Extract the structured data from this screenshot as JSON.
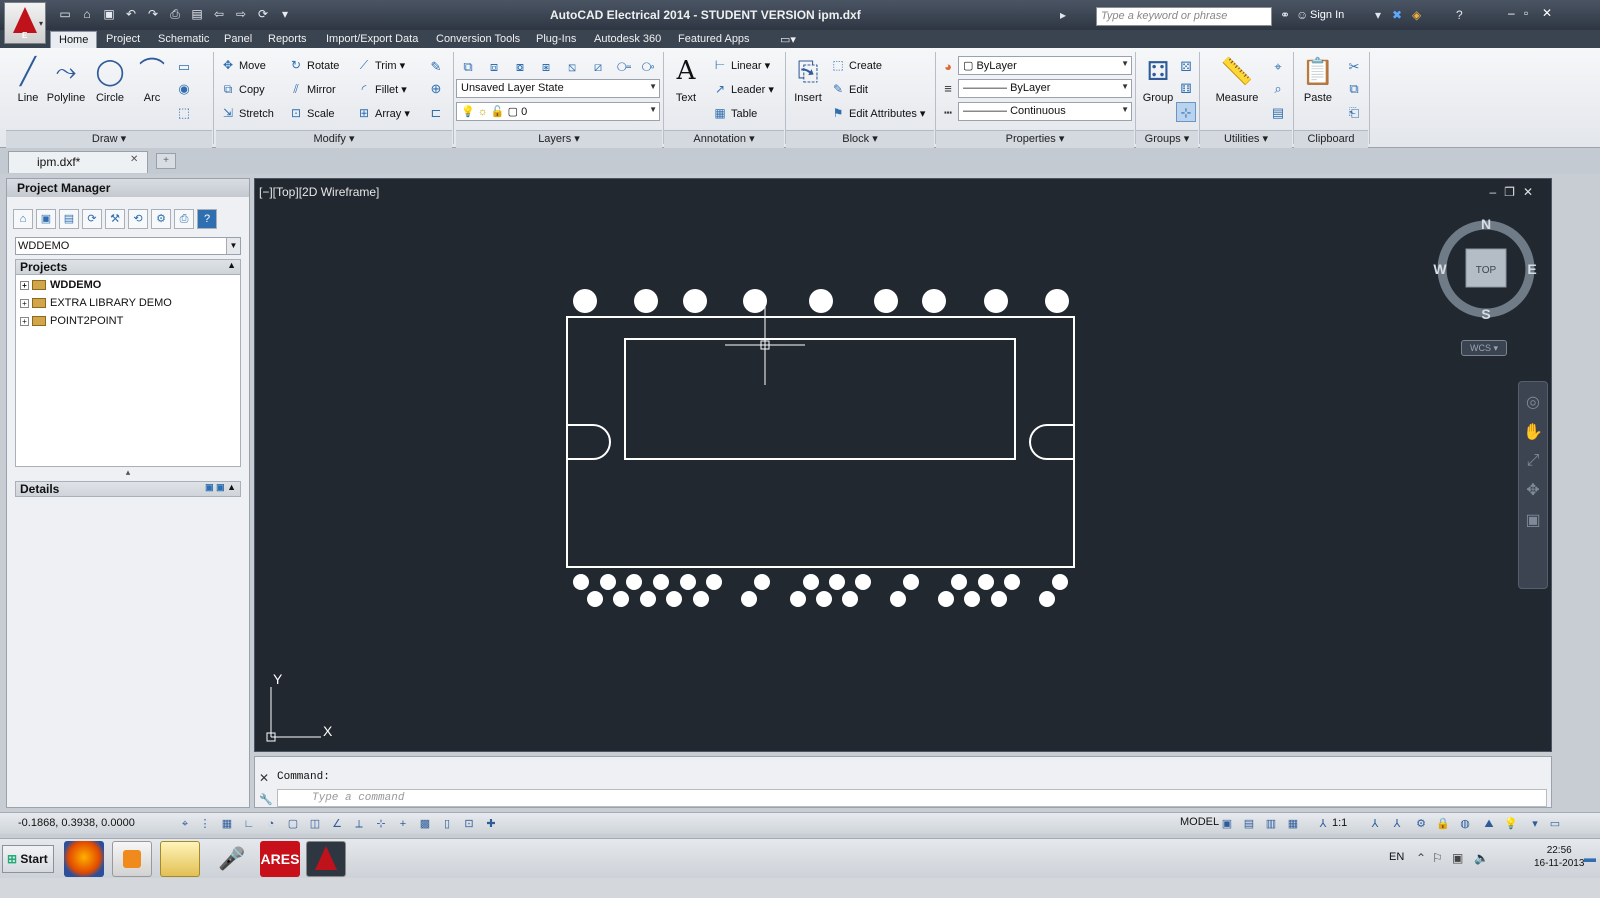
{
  "titlebar": {
    "app_letter": "E",
    "title": "AutoCAD Electrical 2014 - STUDENT VERSION    ipm.dxf",
    "search_placeholder": "Type a keyword or phrase",
    "signin": "Sign In"
  },
  "tabs": [
    "Home",
    "Project",
    "Schematic",
    "Panel",
    "Reports",
    "Import/Export Data",
    "Conversion Tools",
    "Plug-Ins",
    "Autodesk 360",
    "Featured Apps"
  ],
  "active_tab": "Home",
  "ribbon": {
    "draw": {
      "title": "Draw",
      "line": "Line",
      "polyline": "Polyline",
      "circle": "Circle",
      "arc": "Arc"
    },
    "modify": {
      "title": "Modify",
      "move": "Move",
      "rotate": "Rotate",
      "trim": "Trim",
      "copy": "Copy",
      "mirror": "Mirror",
      "fillet": "Fillet",
      "stretch": "Stretch",
      "scale": "Scale",
      "array": "Array"
    },
    "layers": {
      "title": "Layers",
      "layer_state": "Unsaved Layer State",
      "current_layer": "0"
    },
    "annotation": {
      "title": "Annotation",
      "text": "Text",
      "linear": "Linear",
      "leader": "Leader",
      "table": "Table"
    },
    "block": {
      "title": "Block",
      "insert": "Insert",
      "create": "Create",
      "edit": "Edit",
      "edit_attributes": "Edit Attributes"
    },
    "properties": {
      "title": "Properties",
      "color": "ByLayer",
      "lineweight": "ByLayer",
      "linetype": "Continuous"
    },
    "groups": {
      "title": "Groups",
      "group": "Group"
    },
    "utilities": {
      "title": "Utilities",
      "measure": "Measure"
    },
    "clipboard": {
      "title": "Clipboard",
      "paste": "Paste"
    }
  },
  "doc_tab": {
    "name": "ipm.dxf*"
  },
  "project_manager": {
    "title": "Project Manager",
    "selected_project": "WDDEMO",
    "projects_header": "Projects",
    "projects": [
      "WDDEMO",
      "EXTRA LIBRARY DEMO",
      "POINT2POINT"
    ],
    "details_header": "Details"
  },
  "viewport": {
    "label": "[−][Top][2D Wireframe]",
    "viewcube": {
      "n": "N",
      "s": "S",
      "e": "E",
      "w": "W",
      "face": "TOP",
      "wcs": "WCS"
    },
    "ucs_x": "X",
    "ucs_y": "Y"
  },
  "command": {
    "history": "Command:",
    "placeholder": "Type a command"
  },
  "status": {
    "coords": "-0.1868, 0.3938, 0.0000",
    "model": "MODEL",
    "scale": "1:1"
  },
  "taskbar": {
    "start": "Start",
    "lang": "EN",
    "time": "22:56",
    "date": "16-11-2013"
  },
  "colors": {
    "canvas": "#212830",
    "ribbon_title_bg": "#2e3642",
    "accent_red": "#c0121b"
  },
  "icons": [
    "search-icon",
    "binoculars-icon",
    "user-icon",
    "help-icon",
    "close-icon",
    "folder-icon"
  ]
}
